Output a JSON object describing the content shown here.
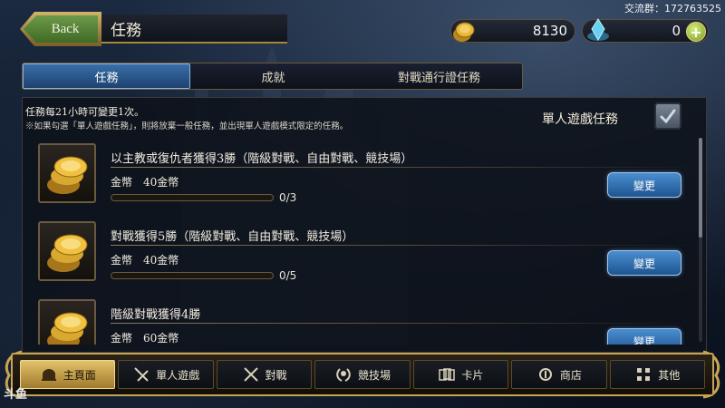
{
  "watermark": "交流群：172763525",
  "header": {
    "back_label": "Back",
    "title": "任務",
    "gold": "8130",
    "crystals": "0",
    "plus_symbol": "+"
  },
  "tabs": [
    {
      "label": "任務",
      "active": true
    },
    {
      "label": "成就",
      "active": false
    },
    {
      "label": "對戰通行證任務",
      "active": false
    }
  ],
  "info": {
    "line1": "任務每21小時可變更1次。",
    "line2": "※如果勾選「單人遊戲任務」，則將放棄一般任務，並出現單人遊戲模式限定的任務。",
    "solo_label": "單人遊戲任務"
  },
  "missions": [
    {
      "title": "以主教或復仇者獲得3勝（階級對戰、自由對戰、競技場）",
      "reward": "金幣　40金幣",
      "progress": "0/3",
      "fraction": 0,
      "button": "變更",
      "icon": "gold-coins-icon"
    },
    {
      "title": "對戰獲得5勝（階級對戰、自由對戰、競技場）",
      "reward": "金幣　40金幣",
      "progress": "0/5",
      "fraction": 0,
      "button": "變更",
      "icon": "gold-coins-icon"
    },
    {
      "title": "階級對戰獲得4勝",
      "reward": "金幣　60金幣",
      "progress": "",
      "fraction": 0,
      "button": "變更",
      "icon": "gold-coins-icon"
    }
  ],
  "nav": [
    {
      "label": "主頁面",
      "icon": "home-icon",
      "active": true
    },
    {
      "label": "單人遊戲",
      "icon": "solo-swords-icon",
      "active": false
    },
    {
      "label": "對戰",
      "icon": "crossed-swords-icon",
      "active": false
    },
    {
      "label": "競技場",
      "icon": "laurel-icon",
      "active": false
    },
    {
      "label": "卡片",
      "icon": "cards-icon",
      "active": false
    },
    {
      "label": "商店",
      "icon": "shop-icon",
      "active": false
    },
    {
      "label": "其他",
      "icon": "other-icon",
      "active": false
    }
  ],
  "brand_logo": "斗鱼",
  "colors": {
    "accent_gold": "#c8a452",
    "tab_active": "#3a6fa8",
    "change_button": "#2e70b0"
  }
}
